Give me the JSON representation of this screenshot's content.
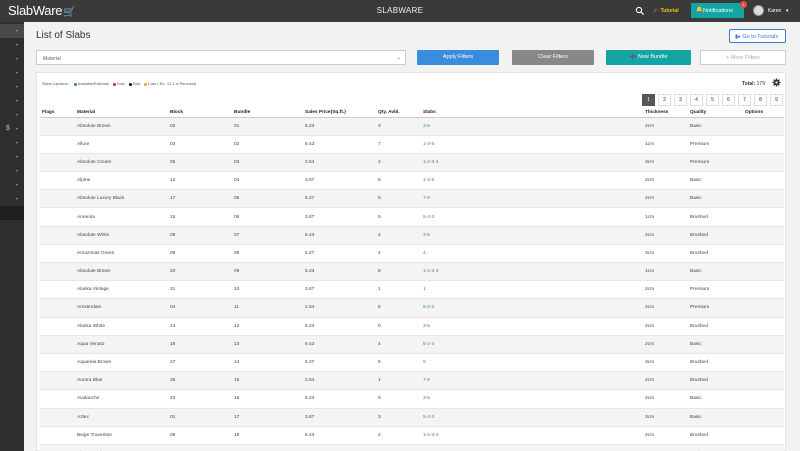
{
  "topbar": {
    "logo": "SlabWare",
    "brand": "SLABWARE",
    "tutorial": "Tutorial",
    "notifications": "Notifications",
    "notification_count": "1",
    "user": "Karen"
  },
  "sidebar": {
    "items": [
      {
        "icon": "dashboard-icon",
        "active": true
      },
      {
        "icon": "hammer-icon"
      },
      {
        "icon": "pencil-icon"
      },
      {
        "icon": "truck-icon"
      },
      {
        "icon": "cart-icon"
      },
      {
        "icon": "box-icon"
      },
      {
        "icon": "briefcase-icon"
      },
      {
        "icon": "dollar-icon"
      },
      {
        "icon": "folder-icon"
      },
      {
        "icon": "chart-icon"
      },
      {
        "icon": "users-icon"
      },
      {
        "icon": "monitor-icon"
      },
      {
        "icon": "settings-icon"
      },
      {
        "icon": "expand-icon"
      }
    ]
  },
  "page": {
    "title": "List of Slabs",
    "go_to_tutorials": "Go to Tutorials",
    "filter_placeholder": "Material",
    "apply_filters": "Apply Filters",
    "clear_filters": "Clear Filters",
    "new_bundle": "New Bundle",
    "more_filters": "+ More Filters"
  },
  "caption": {
    "label": "Slabs Captions:",
    "items": [
      {
        "label": "Available/Estimate",
        "color": "#2e9b2e"
      },
      {
        "label": "Hold",
        "color": "#d62728"
      },
      {
        "label": "Sold",
        "color": "#111111"
      },
      {
        "label": "Loss ( Ex.: 21.1 is Remnant)",
        "color": "#f0a500"
      }
    ]
  },
  "total": {
    "label": "Total:",
    "value": "179"
  },
  "pagination": [
    "1",
    "2",
    "3",
    "4",
    "5",
    "6",
    "7",
    "8",
    "9"
  ],
  "columns": [
    "Flags",
    "Material",
    "Block",
    "Bundle",
    "Sales Price(Sq.ft.)",
    "Qty. Avbl.",
    "Slabs",
    "Thickness",
    "Quality",
    "Options"
  ],
  "rows": [
    {
      "material": "Absolute Brown",
      "block": "02",
      "bundle": "01",
      "price": "5.23",
      "qty": "3",
      "slabs": "3-5",
      "thickness": "2cm",
      "quality": "Basic"
    },
    {
      "material": "Allure",
      "block": "03",
      "bundle": "02",
      "price": "6.43",
      "qty": "7",
      "slabs": "1-3-5",
      "thickness": "1cm",
      "quality": "Premium"
    },
    {
      "material": "Absolute Cream",
      "block": "05",
      "bundle": "03",
      "price": "2.54",
      "qty": "2",
      "slabs": "1-2-3-4",
      "thickness": "3cm",
      "quality": "Premium"
    },
    {
      "material": "Alpine",
      "block": "12",
      "bundle": "04",
      "price": "3.67",
      "qty": "9",
      "slabs": "1-4-5",
      "thickness": "2cm",
      "quality": "Basic"
    },
    {
      "material": "Absolute Luxury Black",
      "block": "17",
      "bundle": "05",
      "price": "5.27",
      "qty": "6",
      "slabs": "7-8",
      "thickness": "2cm",
      "quality": "Basic"
    },
    {
      "material": "Amarula",
      "block": "15",
      "bundle": "06",
      "price": "3.67",
      "qty": "5",
      "slabs": "5-2-3",
      "thickness": "1cm",
      "quality": "Brushed"
    },
    {
      "material": "Absolute White",
      "block": "08",
      "bundle": "07",
      "price": "6.43",
      "qty": "2",
      "slabs": "3-5",
      "thickness": "2cm",
      "quality": "Brushed"
    },
    {
      "material": "Amazonas Green",
      "block": "09",
      "bundle": "08",
      "price": "5.27",
      "qty": "4",
      "slabs": "4",
      "thickness": "3cm",
      "quality": "Brushed"
    },
    {
      "material": "Absolute Brown",
      "block": "20",
      "bundle": "09",
      "price": "5.23",
      "qty": "8",
      "slabs": "1-2-3-4",
      "thickness": "1cm",
      "quality": "Basic"
    },
    {
      "material": "Alaska Vintage",
      "block": "31",
      "bundle": "10",
      "price": "3.67",
      "qty": "1",
      "slabs": "1",
      "thickness": "2cm",
      "quality": "Premium"
    },
    {
      "material": "Amsterdam",
      "block": "04",
      "bundle": "11",
      "price": "2.54",
      "qty": "6",
      "slabs": "5-2-3",
      "thickness": "2cm",
      "quality": "Premium"
    },
    {
      "material": "Alaska White",
      "block": "13",
      "bundle": "12",
      "price": "5.23",
      "qty": "0",
      "slabs": "3-5",
      "thickness": "2cm",
      "quality": "Brushed"
    },
    {
      "material": "Aqua Venato",
      "block": "18",
      "bundle": "13",
      "price": "6.43",
      "qty": "4",
      "slabs": "5-2-3",
      "thickness": "2cm",
      "quality": "Basic"
    },
    {
      "material": "Aquarela Brown",
      "block": "27",
      "bundle": "14",
      "price": "5.27",
      "qty": "6",
      "slabs": "6",
      "thickness": "3cm",
      "quality": "Brushed"
    },
    {
      "material": "Aurora Blue",
      "block": "26",
      "bundle": "15",
      "price": "2.54",
      "qty": "1",
      "slabs": "7-8",
      "thickness": "2cm",
      "quality": "Brushed"
    },
    {
      "material": "Avalanche",
      "block": "23",
      "bundle": "16",
      "price": "5.23",
      "qty": "9",
      "slabs": "3-5",
      "thickness": "2cm",
      "quality": "Basic"
    },
    {
      "material": "Aztec",
      "block": "01",
      "bundle": "17",
      "price": "3.67",
      "qty": "3",
      "slabs": "5-2-3",
      "thickness": "3cm",
      "quality": "Basic"
    },
    {
      "material": "Beige Travertine",
      "block": "06",
      "bundle": "18",
      "price": "6.43",
      "qty": "2",
      "slabs": "1-2-3-4",
      "thickness": "2cm",
      "quality": "Brushed"
    },
    {
      "material": "Bianco Antico",
      "block": "19",
      "bundle": "19",
      "price": "2.54",
      "qty": "5",
      "slabs": "1-2-3-4",
      "thickness": "2cm",
      "quality": "Basic"
    }
  ],
  "colors": {
    "accent": "#15a4a4",
    "primary": "#3a8ddd",
    "slabs_text": "#3c9a3c",
    "check_green": "#2e9b2e",
    "check_red": "#d62728",
    "flag_yellow": "#f0c020"
  }
}
